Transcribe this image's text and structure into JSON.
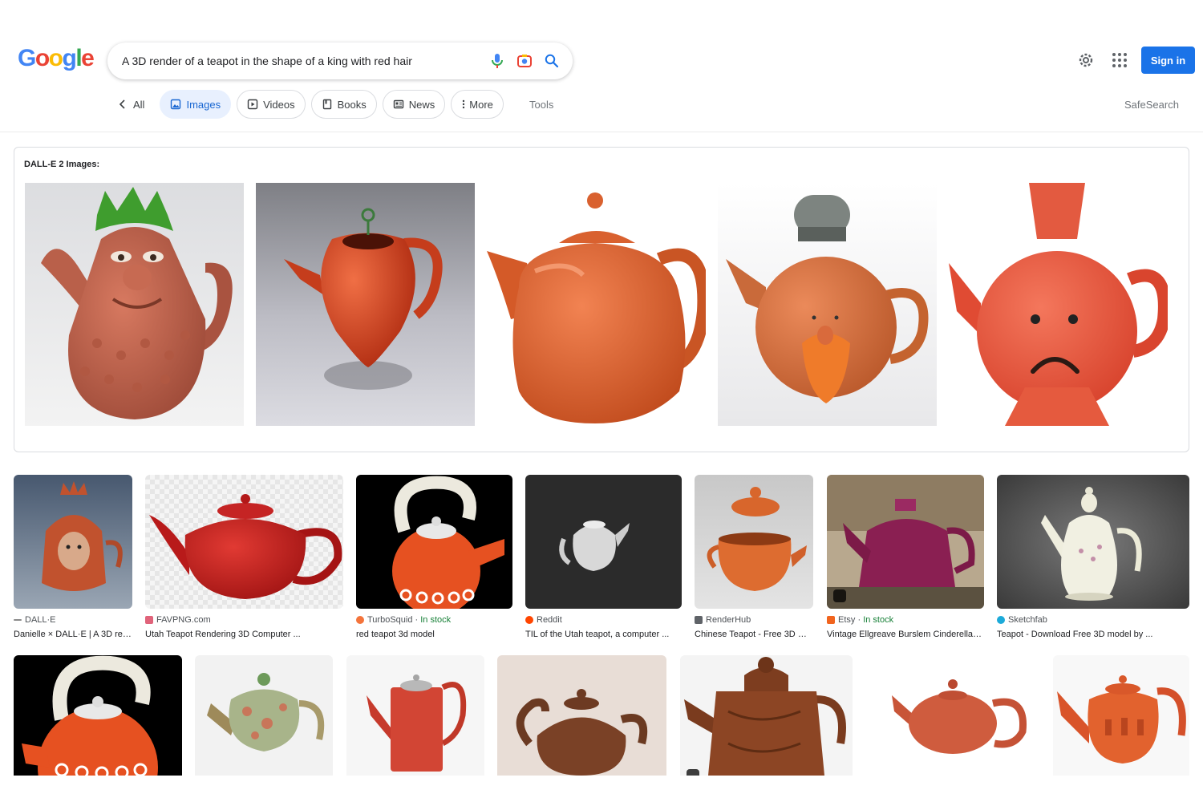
{
  "header": {
    "logo_letters": [
      {
        "char": "G",
        "color": "#4285f4"
      },
      {
        "char": "o",
        "color": "#ea4335"
      },
      {
        "char": "o",
        "color": "#fbbc05"
      },
      {
        "char": "g",
        "color": "#4285f4"
      },
      {
        "char": "l",
        "color": "#34a853"
      },
      {
        "char": "e",
        "color": "#ea4335"
      }
    ],
    "search_query": "A 3D render of a teapot in the shape of a king with red hair",
    "icons": [
      "mic-icon",
      "lens-icon",
      "search-icon",
      "gear-icon",
      "apps-grid-icon"
    ],
    "signin_label": "Sign in"
  },
  "tabs": [
    {
      "label": "All",
      "icon": "chevron-left-icon",
      "active": false
    },
    {
      "label": "Images",
      "icon": "image-icon",
      "active": true
    },
    {
      "label": "Videos",
      "icon": "play-icon",
      "active": false
    },
    {
      "label": "Books",
      "icon": "book-icon",
      "active": false
    },
    {
      "label": "News",
      "icon": "news-icon",
      "active": false
    },
    {
      "label": "More",
      "icon": "dots-vertical-icon",
      "active": false
    }
  ],
  "tools_label": "Tools",
  "safesearch_label": "SafeSearch",
  "dalle": {
    "heading": "DALL-E 2 Images:",
    "images": [
      {
        "desc": "teapot-king-green-crown"
      },
      {
        "desc": "red-teapot-grey-background"
      },
      {
        "desc": "orange-teapot-glossy"
      },
      {
        "desc": "teapot-chef-hat-beard"
      },
      {
        "desc": "red-teapot-sad-face"
      }
    ]
  },
  "results_row1": [
    {
      "source": "DALL·E",
      "stock": "",
      "title": "Danielle × DALL·E | A 3D rend...",
      "accent": "#8a8a8a"
    },
    {
      "source": "FAVPNG.com",
      "stock": "",
      "title": "Utah Teapot Rendering 3D Computer ...",
      "accent": "#e0637a"
    },
    {
      "source": "TurboSquid",
      "stock": "In stock",
      "title": "red teapot 3d model",
      "accent": "#f4743b"
    },
    {
      "source": "Reddit",
      "stock": "",
      "title": "TIL of the Utah teapot, a computer ...",
      "accent": "#ff4500"
    },
    {
      "source": "RenderHub",
      "stock": "",
      "title": "Chinese Teapot - Free 3D Mo...",
      "accent": "#5f6368"
    },
    {
      "source": "Etsy",
      "stock": "In stock",
      "title": "Vintage Ellgreave Burslem Cinderella 3...",
      "accent": "#f1641e"
    },
    {
      "source": "Sketchfab",
      "stock": "",
      "title": "Teapot - Download Free 3D model by ...",
      "accent": "#1caad9"
    }
  ],
  "colors": {
    "accent_blue": "#1a73e8",
    "active_tab_bg": "#e8f0fe",
    "stock_green": "#188038",
    "teapot_orange": "#e0622e"
  }
}
